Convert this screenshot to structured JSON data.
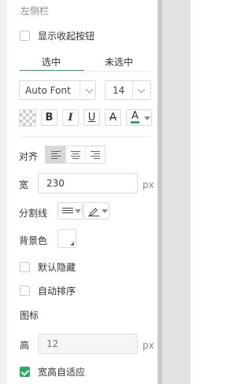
{
  "sidebar": {
    "section_title": "左侧栏",
    "show_collapse": {
      "label": "显示收起按钮"
    },
    "tabs": [
      {
        "label": "选中"
      },
      {
        "label": "未选中"
      }
    ]
  },
  "font": {
    "family": "Auto Font",
    "size": "14"
  },
  "style": {
    "bold": "B",
    "italic": "I",
    "underline": "U",
    "strike": "A",
    "color": "A"
  },
  "align": {
    "label": "对齐"
  },
  "width": {
    "label": "宽",
    "value": "230",
    "unit": "px"
  },
  "divider": {
    "label": "分割线"
  },
  "background": {
    "label": "背景色"
  },
  "default_hide": {
    "label": "默认隐藏"
  },
  "auto_sort": {
    "label": "自动排序"
  },
  "icon_section": {
    "label": "图标"
  },
  "height": {
    "label": "高",
    "placeholder": "12",
    "unit": "px"
  },
  "auto_fit": {
    "label": "宽高自适应"
  },
  "colors": {
    "accent": "#2eab63",
    "font_color": "#2eab63"
  }
}
